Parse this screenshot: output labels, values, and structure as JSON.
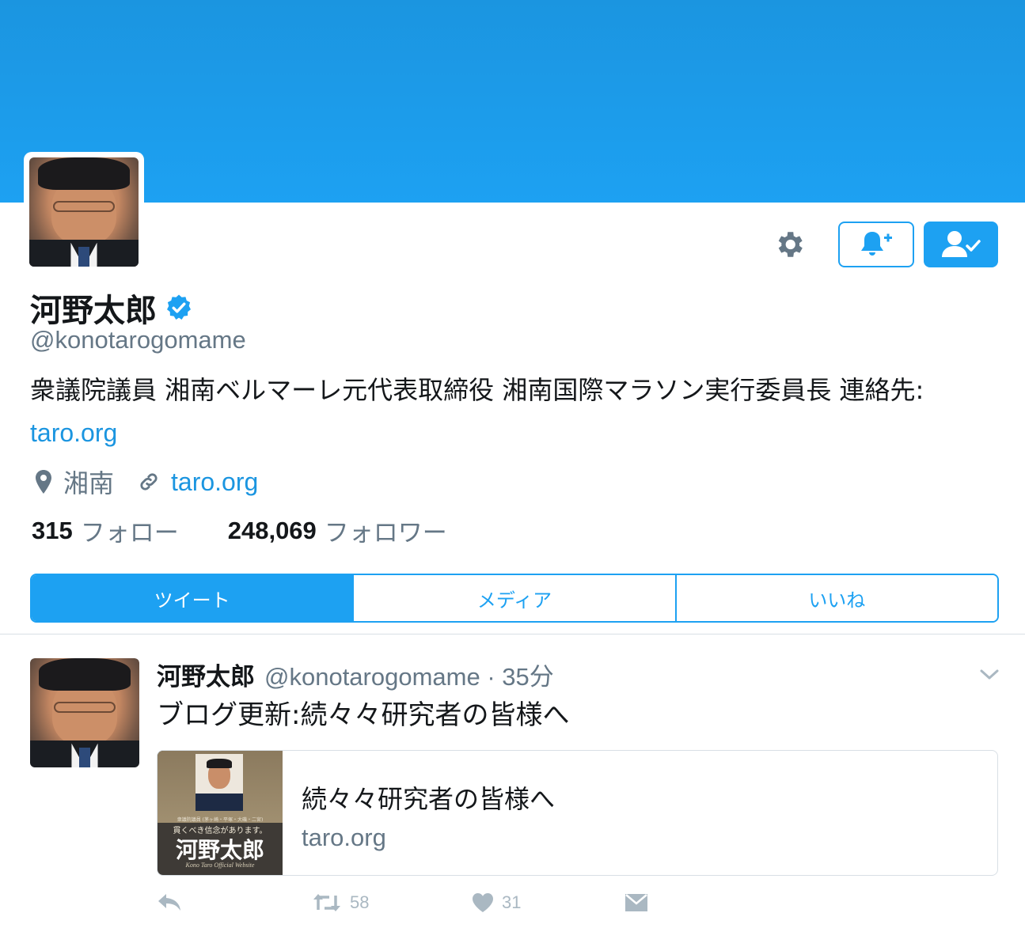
{
  "profile": {
    "name": "河野太郎",
    "handle": "@konotarogomame",
    "bio_text": "衆議院議員 湘南ベルマーレ元代表取締役 湘南国際マラソン実行委員長 連絡先: ",
    "bio_link": "taro.org",
    "location": "湘南",
    "website": "taro.org",
    "following_count": "315",
    "following_label": "フォロー",
    "followers_count": "248,069",
    "followers_label": "フォロワー",
    "verified_icon": "verified-badge-icon"
  },
  "colors": {
    "accent": "#1da1f2",
    "banner": "#1da1f2",
    "muted": "#657786"
  },
  "tabs": [
    {
      "label": "ツイート",
      "active": true
    },
    {
      "label": "メディア",
      "active": false
    },
    {
      "label": "いいね",
      "active": false
    }
  ],
  "tweet": {
    "name": "河野太郎",
    "handle_time": "@konotarogomame · 35分",
    "text": "ブログ更新:続々々研究者の皆様へ",
    "card": {
      "title": "続々々研究者の皆様へ",
      "domain": "taro.org",
      "thumb_line1": "衆議院議員 (茅ヶ崎・平塚・大磯・二宮)",
      "thumb_line2": "貫くべき信念があります。",
      "thumb_name": "河野太郎",
      "thumb_footer": "Kono Taro Official Website"
    },
    "retweets": "58",
    "likes": "31"
  }
}
